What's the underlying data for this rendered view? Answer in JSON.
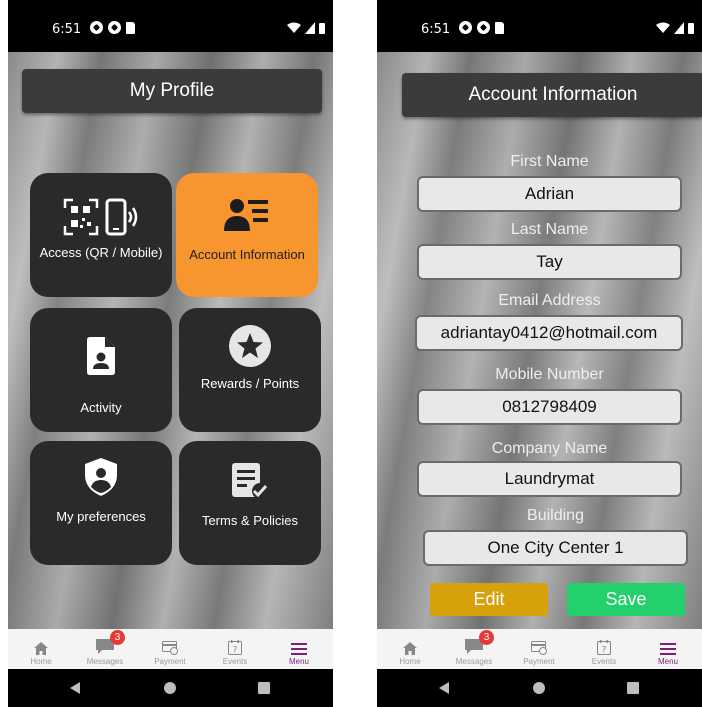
{
  "status": {
    "time": "6:51"
  },
  "left_screen": {
    "title": "My Profile",
    "tiles": [
      {
        "label": "Access  (QR / Mobile)",
        "icon": "qr-phone-icon"
      },
      {
        "label": "Account Information",
        "icon": "profile-card-icon"
      },
      {
        "label": "Activity",
        "icon": "document-person-icon"
      },
      {
        "label": "Rewards / Points",
        "icon": "star-circle-icon"
      },
      {
        "label": "My preferences",
        "icon": "user-shield-icon"
      },
      {
        "label": "Terms & Policies",
        "icon": "document-check-icon"
      }
    ]
  },
  "right_screen": {
    "title": "Account Information",
    "fields": [
      {
        "label": "First Name",
        "value": "Adrian"
      },
      {
        "label": "Last Name",
        "value": "Tay"
      },
      {
        "label": "Email Address",
        "value": "adriantay0412@hotmail.com"
      },
      {
        "label": "Mobile Number",
        "value": "0812798409"
      },
      {
        "label": "Company Name",
        "value": "Laundrymat"
      },
      {
        "label": "Building",
        "value": "One City Center 1"
      }
    ],
    "edit_label": "Edit",
    "save_label": "Save"
  },
  "nav": {
    "items": [
      {
        "label": "Home",
        "icon": "home-icon"
      },
      {
        "label": "Messages",
        "icon": "chat-icon",
        "badge": "3"
      },
      {
        "label": "Payment",
        "icon": "payment-icon"
      },
      {
        "label": "Events",
        "icon": "calendar-question-icon"
      },
      {
        "label": "Menu",
        "icon": "menu-icon"
      }
    ]
  },
  "colors": {
    "highlight": "#f7952f",
    "edit": "#d6a10b",
    "save": "#23d06b",
    "active_nav": "#7a1f7a"
  }
}
